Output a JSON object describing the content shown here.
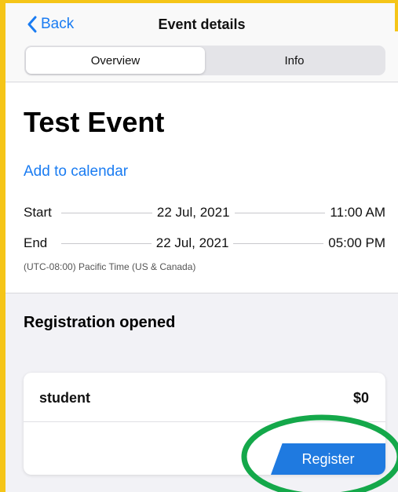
{
  "navbar": {
    "back_label": "Back",
    "title": "Event details",
    "tabs": [
      {
        "label": "Overview",
        "active": true
      },
      {
        "label": "Info",
        "active": false
      }
    ]
  },
  "event": {
    "title": "Test Event",
    "add_to_calendar": "Add to calendar",
    "start": {
      "label": "Start",
      "date": "22 Jul, 2021",
      "time": "11:00 AM"
    },
    "end": {
      "label": "End",
      "date": "22 Jul, 2021",
      "time": "05:00 PM"
    },
    "timezone": "(UTC-08:00) Pacific Time (US & Canada)"
  },
  "registration": {
    "status": "Registration opened",
    "ticket": {
      "name": "student",
      "price": "$0"
    },
    "register_label": "Register"
  },
  "colors": {
    "accent": "#1a7cf2",
    "register_button": "#1f7ae0",
    "highlight": "#14a84a",
    "frame_border": "#f5c518"
  },
  "icons": {
    "back": "chevron-left-icon"
  }
}
